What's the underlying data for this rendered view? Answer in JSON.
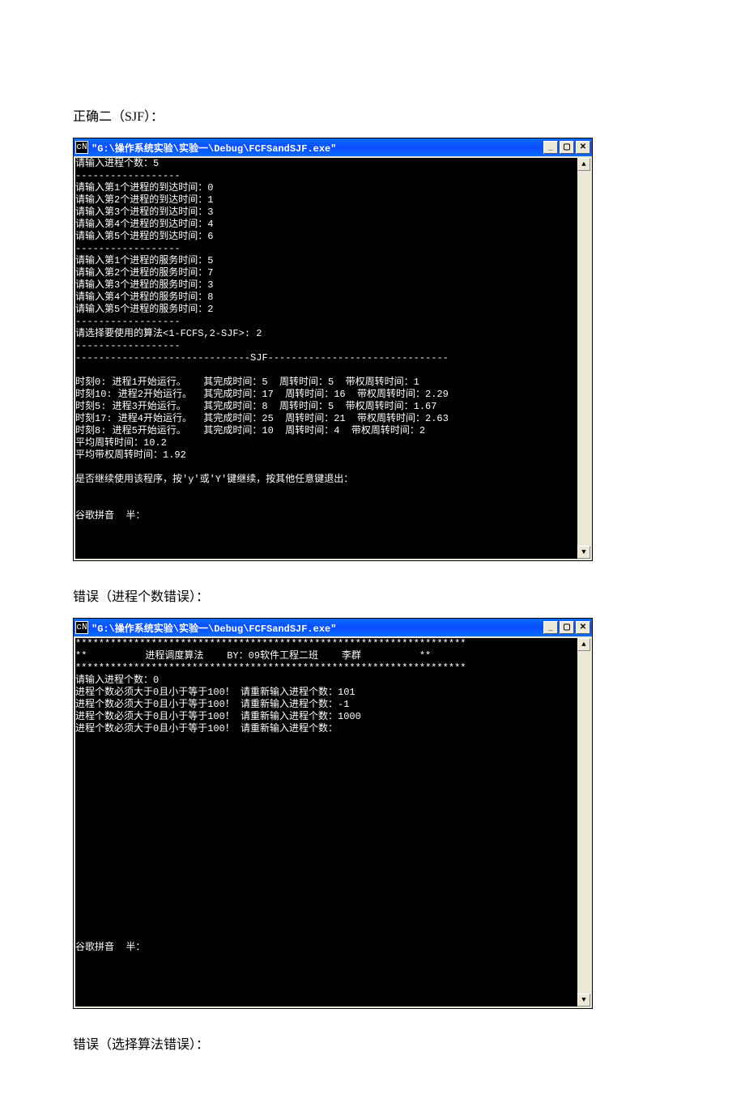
{
  "caption1": "正确二（SJF）：",
  "caption2": "错误（进程个数错误）：",
  "caption3": "错误（选择算法错误）：",
  "window": {
    "title": "\"G:\\操作系统实验\\实验一\\Debug\\FCFSandSJF.exe\"",
    "icon_label": "C:\\"
  },
  "console1_text": "请输入进程个数：5\n------------------\n请输入第1个进程的到达时间：0\n请输入第2个进程的到达时间：1\n请输入第3个进程的到达时间：3\n请输入第4个进程的到达时间：4\n请输入第5个进程的到达时间：6\n------------------\n请输入第1个进程的服务时间：5\n请输入第2个进程的服务时间：7\n请输入第3个进程的服务时间：3\n请输入第4个进程的服务时间：8\n请输入第5个进程的服务时间：2\n------------------\n请选择要使用的算法<1-FCFS,2-SJF>: 2\n------------------\n------------------------------SJF-------------------------------\n\n时刻0: 进程1开始运行。   其完成时间：5  周转时间：5  带权周转时间：1\n时刻10: 进程2开始运行。  其完成时间：17  周转时间：16  带权周转时间：2.29\n时刻5: 进程3开始运行。   其完成时间：8  周转时间：5  带权周转时间：1.67\n时刻17: 进程4开始运行。  其完成时间：25  周转时间：21  带权周转时间：2.63\n时刻8: 进程5开始运行。   其完成时间：10  周转时间：4  带权周转时间：2\n平均周转时间：10.2\n平均带权周转时间：1.92\n\n是否继续使用该程序，按'y'或'Y'键继续，按其他任意键退出：\n\n\n谷歌拼音  半：",
  "console2_text": "*******************************************************************\n**          进程调度算法    BY：09软件工程二班    李群          **\n*******************************************************************\n请输入进程个数：0\n进程个数必须大于0且小于等于100！ 请重新输入进程个数：101\n进程个数必须大于0且小于等于100！ 请重新输入进程个数：-1\n进程个数必须大于0且小于等于100！ 请重新输入进程个数：1000\n进程个数必须大于0且小于等于100！ 请重新输入进程个数：\n\n\n\n\n\n\n\n\n\n\n\n\n\n\n\n\n\n谷歌拼音  半："
}
